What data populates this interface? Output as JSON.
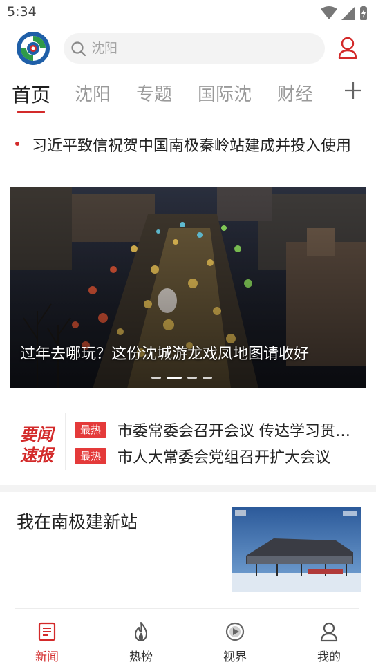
{
  "status_bar": {
    "time": "5:34"
  },
  "search": {
    "placeholder": "沈阳"
  },
  "tabs": [
    {
      "label": "首页",
      "active": true
    },
    {
      "label": "沈阳"
    },
    {
      "label": "专题"
    },
    {
      "label": "国际沈"
    },
    {
      "label": "财经"
    }
  ],
  "headline": {
    "text": "习近平致信祝贺中国南极秦岭站建成并投入使用"
  },
  "banner": {
    "caption": "过年去哪玩？这份沈城游龙戏凤地图请收好",
    "slide_count": 4,
    "active_slide": 2
  },
  "express": {
    "logo_line1": "要闻",
    "logo_line2": "速报",
    "items": [
      {
        "badge": "最热",
        "text": "市委常委会召开会议 传达学习贯彻习近平总书记重要讲话精神"
      },
      {
        "badge": "最热",
        "text": "市人大常委会党组召开扩大会议"
      }
    ]
  },
  "article": {
    "title": "我在南极建新站"
  },
  "bottom_nav": [
    {
      "label": "新闻",
      "icon": "news-icon",
      "active": true
    },
    {
      "label": "热榜",
      "icon": "flame-icon"
    },
    {
      "label": "视界",
      "icon": "video-icon"
    },
    {
      "label": "我的",
      "icon": "profile-icon"
    }
  ],
  "colors": {
    "accent": "#d32a2a",
    "badge": "#e43a3a",
    "logo_blue": "#1f5fa8",
    "logo_green": "#2f9a48"
  }
}
